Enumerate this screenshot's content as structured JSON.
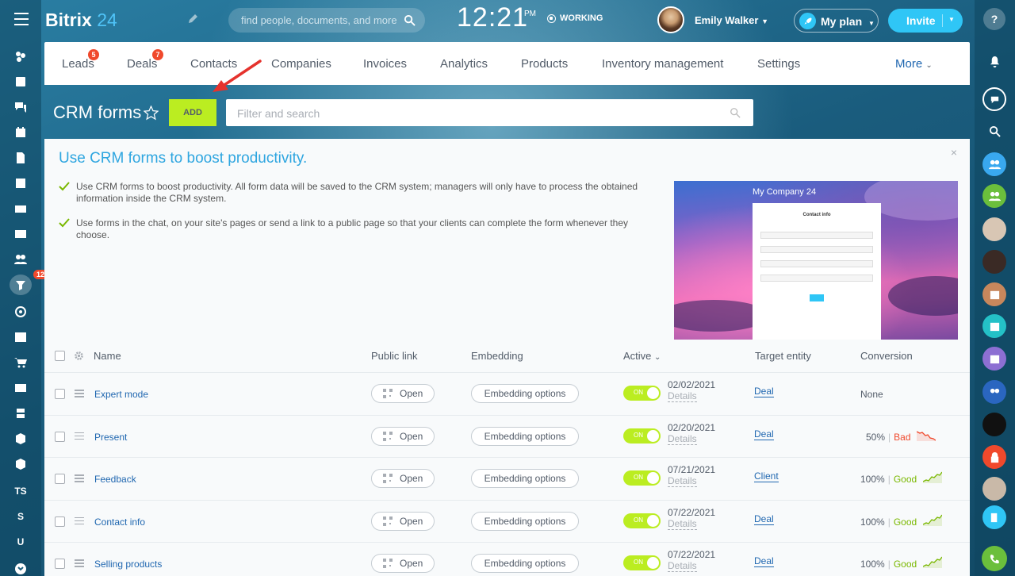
{
  "header": {
    "logo_name": "Bitrix",
    "logo_num": "24",
    "search_placeholder": "find people, documents, and more",
    "clock": "12:21",
    "ampm": "PM",
    "work_status": "WORKING",
    "user_name": "Emily Walker",
    "my_plan": "My plan",
    "invite": "Invite"
  },
  "tabs": [
    {
      "label": "Leads",
      "badge": "5"
    },
    {
      "label": "Deals",
      "badge": "7"
    },
    {
      "label": "Contacts"
    },
    {
      "label": "Companies"
    },
    {
      "label": "Invoices"
    },
    {
      "label": "Analytics"
    },
    {
      "label": "Products"
    },
    {
      "label": "Inventory management"
    },
    {
      "label": "Settings"
    },
    {
      "label": "More"
    }
  ],
  "page": {
    "title": "CRM forms",
    "add_label": "ADD",
    "filter_placeholder": "Filter and search"
  },
  "promo": {
    "title": "Use CRM forms to boost productivity.",
    "close": "×",
    "point1": "Use CRM forms to boost productivity. All form data will be saved to the CRM system; managers will only have to process the obtained information inside the CRM system.",
    "point2": "Use forms in the chat, on your site's pages or send a link to a public page so that your clients can complete the form whenever they choose.",
    "image_company": "My Company 24",
    "image_form_title": "Contact info"
  },
  "sidebar_left": {
    "filter_badge": "12",
    "items": [
      "TS",
      "S",
      "U"
    ]
  },
  "table": {
    "columns": [
      "Name",
      "Public link",
      "Embedding",
      "Active",
      "Target entity",
      "Conversion"
    ],
    "open_label": "Open",
    "embedding_label": "Embedding options",
    "details_label": "Details",
    "toggle_label": "ON",
    "rows": [
      {
        "name": "Expert mode",
        "date": "02/02/2021",
        "entity": "Deal",
        "conv_pct": "None",
        "conv_status": ""
      },
      {
        "name": "Present",
        "date": "02/20/2021",
        "entity": "Deal",
        "conv_pct": "50%",
        "conv_status": "Bad"
      },
      {
        "name": "Feedback",
        "date": "07/21/2021",
        "entity": "Client",
        "conv_pct": "100%",
        "conv_status": "Good"
      },
      {
        "name": "Contact info",
        "date": "07/22/2021",
        "entity": "Deal",
        "conv_pct": "100%",
        "conv_status": "Good"
      },
      {
        "name": "Selling products",
        "date": "07/22/2021",
        "entity": "Deal",
        "conv_pct": "100%",
        "conv_status": "Good"
      }
    ]
  },
  "colors": {
    "accent_green": "#bbed21",
    "link_blue": "#2067b0",
    "invite_blue": "#2fc6f6",
    "badge_red": "#f0492c"
  }
}
